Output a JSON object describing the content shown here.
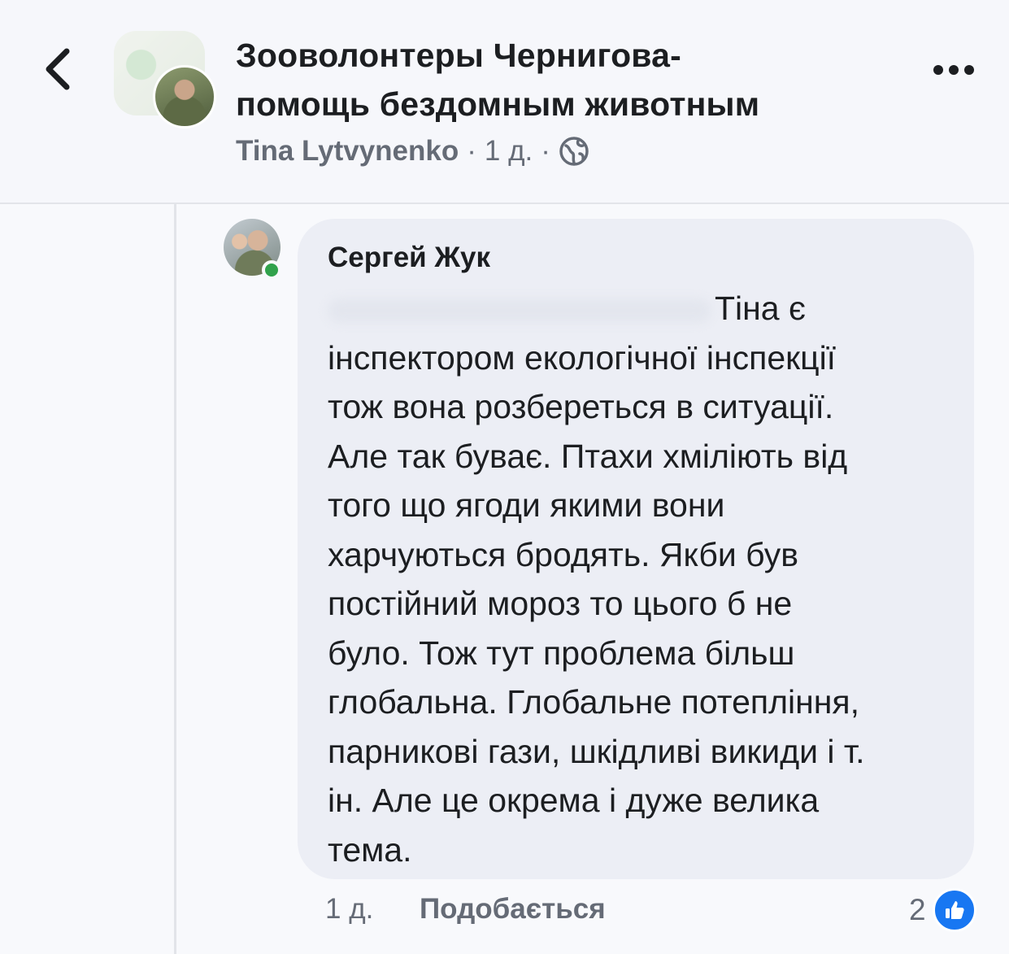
{
  "header": {
    "title_line1": "Зооволонтеры Чернигова-",
    "title_line2": "помощь бездомным животным",
    "author": "Tina Lytvynenko",
    "separator": "·",
    "time": "1 д.",
    "icons": {
      "back": "chevron-left-icon",
      "more": "more-options-icon",
      "privacy": "globe-icon"
    }
  },
  "comment": {
    "author": "Сергей Жук",
    "text_first": "Тіна є",
    "text_rest": "інспектором екологічної інспекції\nтож вона розбереться в ситуації.\nАле так буває. Птахи хміліють від\nтого що ягоди якими вони\nхарчуються бродять. Якби був\nпостійний мороз то цього б не\nбуло. Тож тут проблема більш\nглобальна. Глобальне потепління,\nпарникові гази, шкідливі викиди і т.\nін. Але це окрема і дуже велика\nтема.",
    "time": "1 д.",
    "like_label": "Подобається",
    "reaction_count": "2",
    "author_online": true
  },
  "colors": {
    "like_blue": "#1877f2",
    "online_green": "#31a24c",
    "bubble_bg": "#eceef5",
    "secondary_text": "#656b76"
  }
}
